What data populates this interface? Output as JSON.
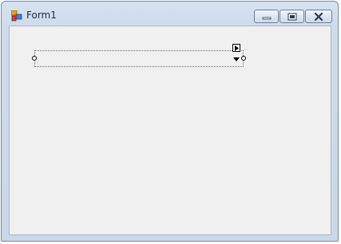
{
  "window": {
    "title": "Form1"
  },
  "icons": {
    "app": "form-app-icon",
    "minimize": "minimize-icon",
    "maximize": "maximize-icon",
    "close": "close-icon",
    "dropdown": "chevron-down-icon",
    "smart_tag": "smart-tag-arrow-icon"
  },
  "combo": {
    "value": ""
  },
  "colors": {
    "frame": "#c9d8ea",
    "client": "#f0f0f0"
  }
}
